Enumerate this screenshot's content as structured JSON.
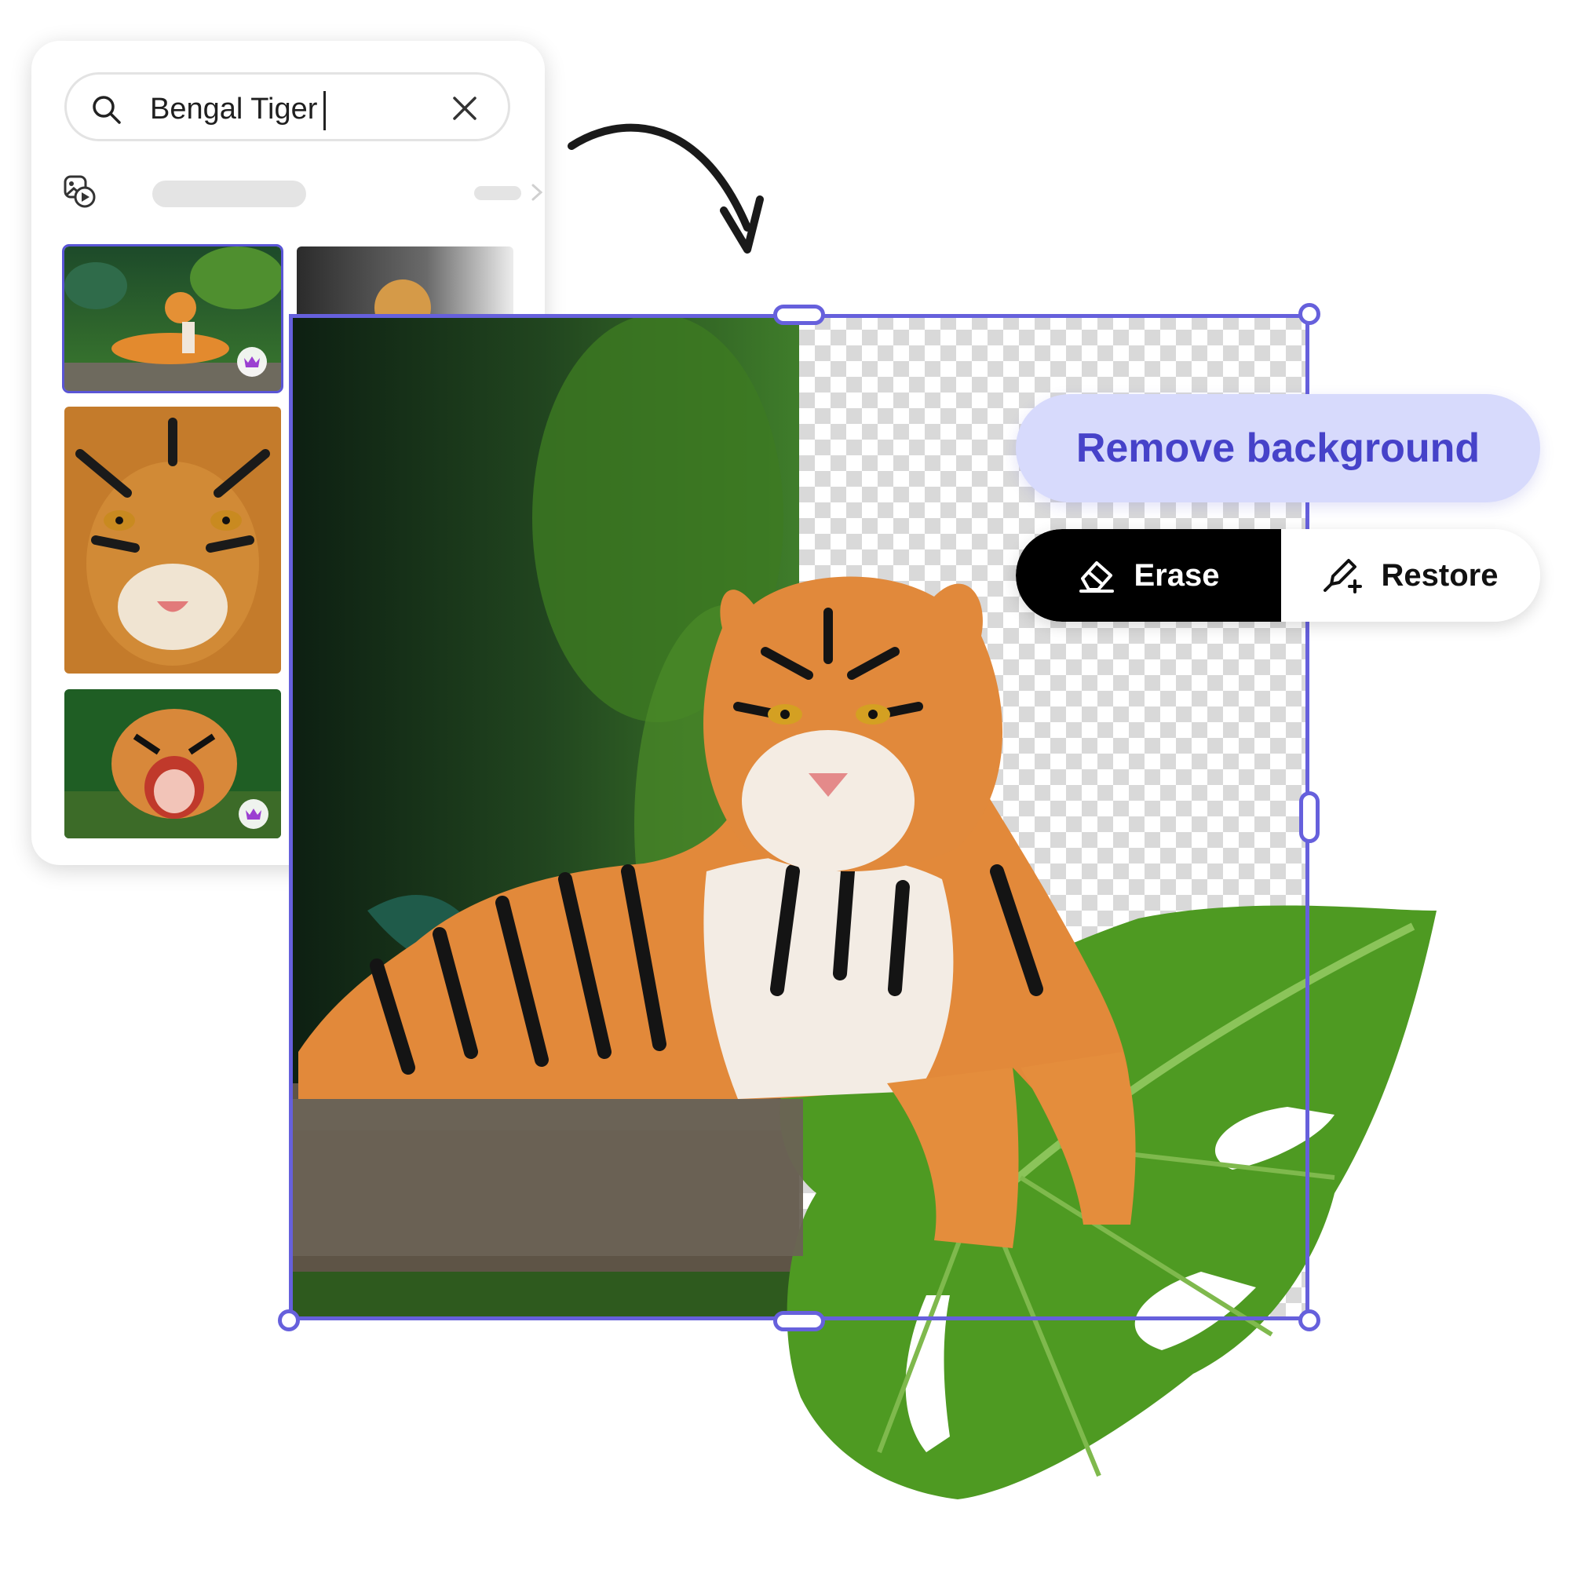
{
  "search": {
    "query": "Bengal Tiger",
    "icon": "search-icon",
    "clear_icon": "close-icon"
  },
  "filter": {
    "icon": "media-filter-icon",
    "more_icon": "chevron-right-icon"
  },
  "results": [
    {
      "id": "tiger-resting-jungle",
      "premium": true,
      "selected": true
    },
    {
      "id": "tiger-sitting-cave",
      "premium": false,
      "selected": false
    },
    {
      "id": "tiger-face-closeup",
      "premium": false,
      "selected": false
    },
    {
      "id": "tiger-roaring-dark",
      "premium": true,
      "selected": false
    },
    {
      "id": "tiger-standing-forest",
      "premium": true,
      "selected": false
    },
    {
      "id": "tiger-roaring-water",
      "premium": true,
      "selected": false
    },
    {
      "id": "tiger-face-dark",
      "premium": false,
      "selected": false
    }
  ],
  "actions": {
    "remove_background": "Remove background",
    "erase": "Erase",
    "restore": "Restore"
  },
  "colors": {
    "accent": "#6660dc",
    "accent_text": "#4642c9",
    "accent_soft": "#d7dafc",
    "premium": "#9b3fd1"
  }
}
